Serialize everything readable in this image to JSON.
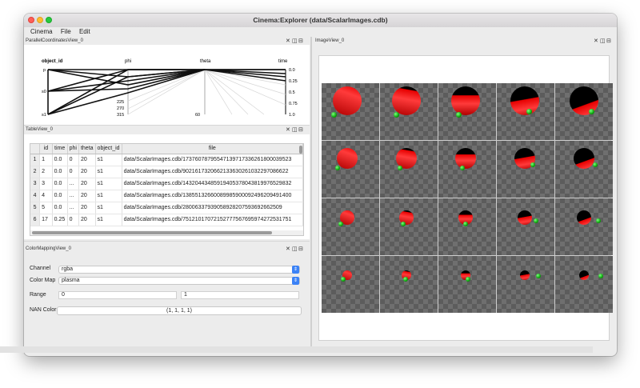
{
  "window": {
    "title": "Cinema:Explorer (data/ScalarImages.cdb)"
  },
  "menu": [
    "Cinema",
    "File",
    "Edit"
  ],
  "panels": {
    "parallel": {
      "title": "ParallelCoordinatesView_0"
    },
    "table": {
      "title": "TableView_0"
    },
    "colormap": {
      "title": "ColorMappingView_0"
    },
    "image": {
      "title": "ImageView_0"
    }
  },
  "parallel": {
    "axes": [
      "object_id",
      "phi",
      "theta",
      "time"
    ],
    "object_id_ticks": [
      "p",
      "s0",
      "s1"
    ],
    "phi_ticks": [
      "225",
      "270",
      "315"
    ],
    "theta_ticks": [
      "60"
    ],
    "time_ticks": [
      "0.0",
      "0.25",
      "0.5",
      "0.75",
      "1.0"
    ]
  },
  "table": {
    "columns": [
      "",
      "id",
      "time",
      "phi",
      "theta",
      "object_id",
      "file"
    ],
    "rows": [
      [
        "1",
        "1",
        "0.0",
        "0",
        "20",
        "s1",
        "data/ScalarImages.cdb/17376078795547139717336261800039523"
      ],
      [
        "2",
        "2",
        "0.0",
        "0",
        "20",
        "s1",
        "data/ScalarImages.cdb/9021617320662133630261032297086622"
      ],
      [
        "3",
        "3",
        "0.0",
        "...",
        "20",
        "s1",
        "data/ScalarImages.cdb/14320443485919405378043819976529832"
      ],
      [
        "4",
        "4",
        "0.0",
        "...",
        "20",
        "s1",
        "data/ScalarImages.cdb/13855132660089985900092496209491400"
      ],
      [
        "5",
        "5",
        "0.0",
        "...",
        "20",
        "s1",
        "data/ScalarImages.cdb/28006337939058928207593692662509"
      ],
      [
        "6",
        "17",
        "0.25",
        "0",
        "20",
        "s1",
        "data/ScalarImages.cdb/75121017072152777567695974272531751"
      ]
    ]
  },
  "colormap": {
    "channel_label": "Channel",
    "channel_value": "rgba",
    "colormap_label": "Color Map",
    "colormap_value": "plasma",
    "range_label": "Range",
    "range_min": "0",
    "range_max": "1",
    "nan_label": "NAN Color",
    "nan_value": "(1, 1, 1, 1)"
  },
  "icons": [
    "close-icon",
    "split-vertical-icon",
    "split-horizontal-icon"
  ],
  "colors": {
    "sphere_red": "#e00000",
    "sphere_green": "#1fcf1f",
    "accent": "#3b82f6"
  }
}
